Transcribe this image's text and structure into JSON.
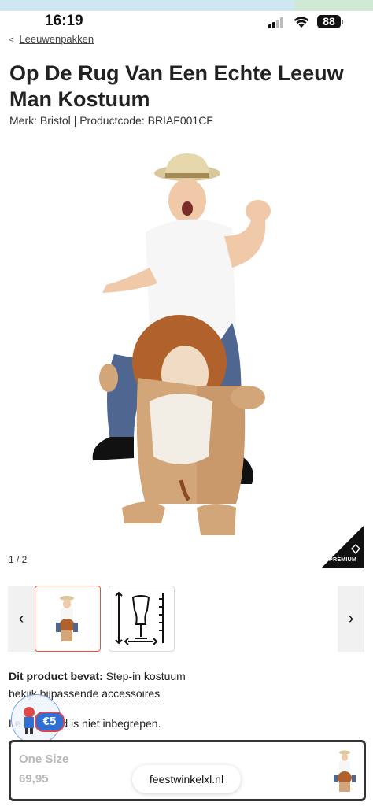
{
  "status": {
    "time": "16:19",
    "battery": "88"
  },
  "breadcrumb": {
    "label": "Leeuwenpakken"
  },
  "product": {
    "title": "Op De Rug Van Een Echte Leeuw Man Kostuum",
    "brand_label": "Merk:",
    "brand": "Bristol",
    "code_label": "Productcode:",
    "code": "BRIAF001CF",
    "image_counter": "1 / 2",
    "premium_label": "PREMIUM"
  },
  "details": {
    "contains_label": "Dit product bevat:",
    "contains_value": "Step-in kostuum",
    "accessories_link": "bekijk bijpassende accessoires",
    "excluded_text_start": "Le",
    "excluded_text_end": "ed is niet inbegrepen."
  },
  "promo": {
    "badge": "€5"
  },
  "sticky": {
    "size": "One Size",
    "price": "69,95",
    "site": "feestwinkelxl.nl"
  },
  "icons": [
    "signal-icon",
    "wifi-icon",
    "battery-icon",
    "chevron-left-icon",
    "chevron-right-icon",
    "premium-diamond-icon",
    "size-chart-icon"
  ],
  "colors": {
    "accent_border": "#e0573f",
    "price_grey": "#b8b8b8",
    "promo_blue": "#2f6fd6"
  }
}
